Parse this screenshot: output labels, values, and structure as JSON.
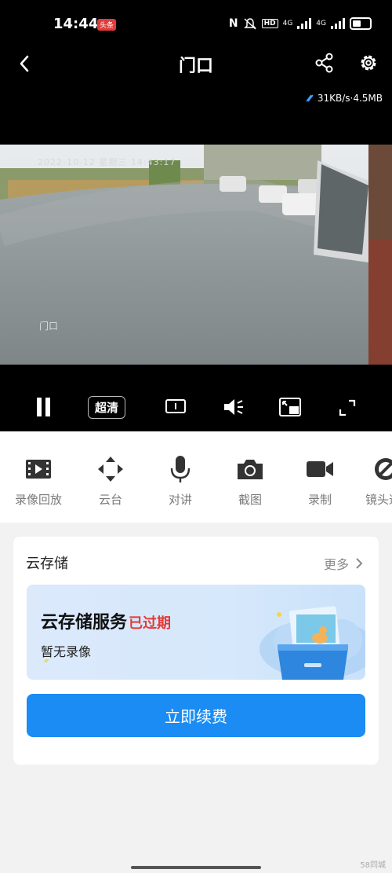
{
  "status": {
    "time": "14:44",
    "badge": "头条",
    "nfc": "N",
    "hd": "HD",
    "net1": "4G",
    "net2": "4G"
  },
  "header": {
    "title": "门口",
    "speed": "31KB/s·4.5MB"
  },
  "video": {
    "osd_date": "2022-10-12 星期三 14:43:17",
    "osd_name": "门口"
  },
  "controls": {
    "quality": "超清"
  },
  "functions": [
    {
      "label": "录像回放",
      "icon": "film-icon"
    },
    {
      "label": "云台",
      "icon": "ptz-icon"
    },
    {
      "label": "对讲",
      "icon": "microphone-icon"
    },
    {
      "label": "截图",
      "icon": "camera-icon"
    },
    {
      "label": "录制",
      "icon": "video-record-icon"
    },
    {
      "label": "镜头遮",
      "icon": "lens-cover-icon"
    }
  ],
  "cloud": {
    "title": "云存储",
    "more": "更多",
    "service_title": "云存储服务",
    "expired": "已过期",
    "no_recording": "暂无录像",
    "renew": "立即续费"
  },
  "watermark": "58同城",
  "colors": {
    "accent": "#1a8cf3",
    "expired": "#e53935"
  }
}
